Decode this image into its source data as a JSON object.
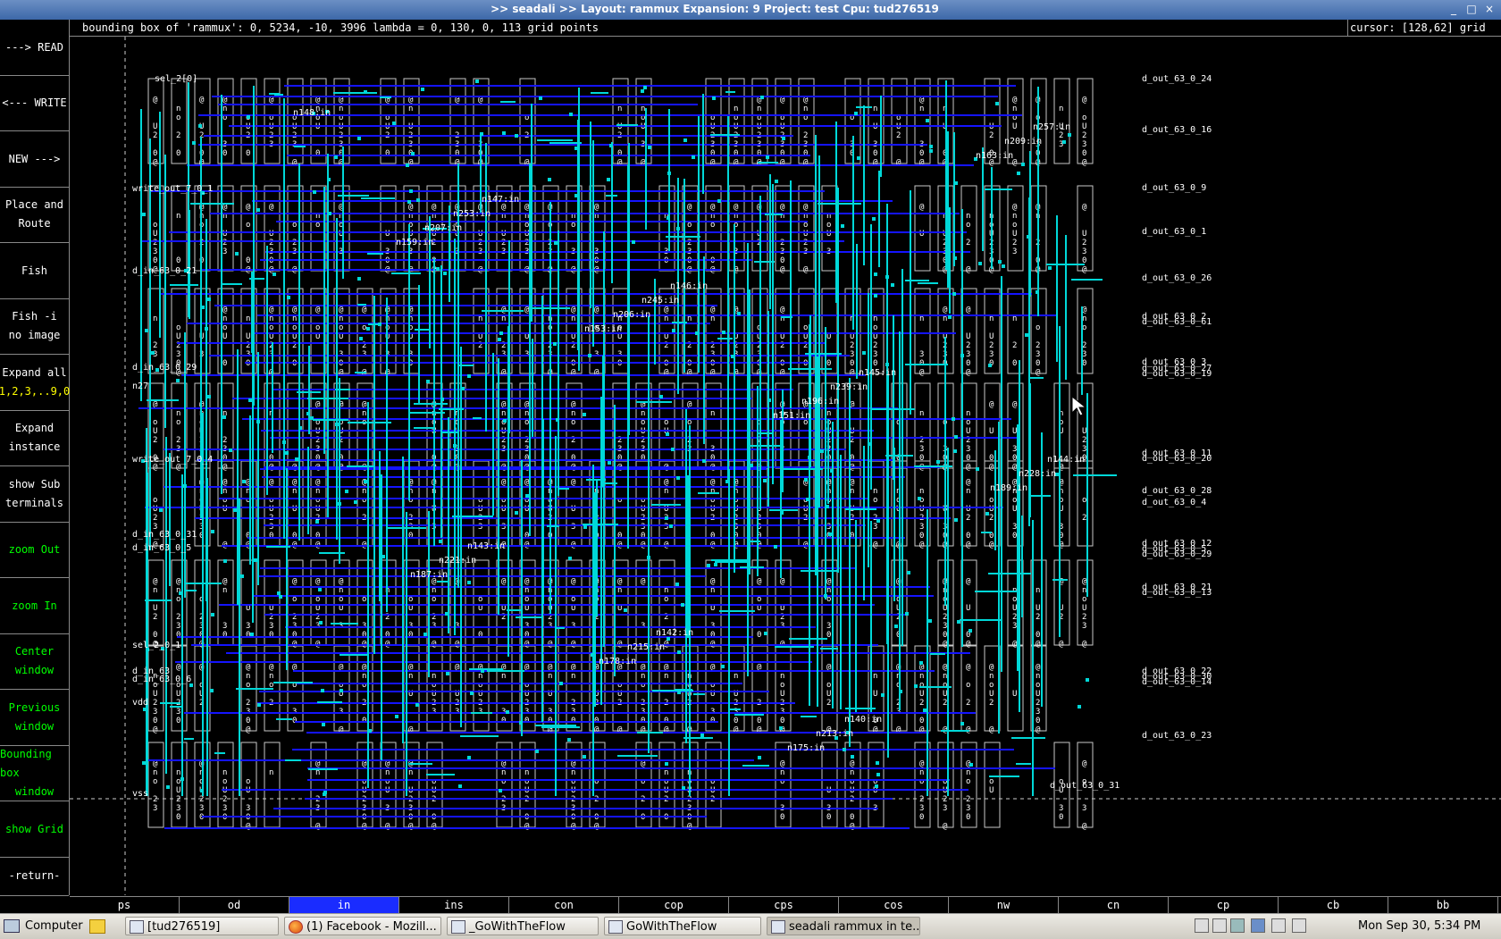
{
  "window": {
    "title": ">> seadali >>   Layout: rammux  Expansion: 9  Project: test  Cpu: tud276519",
    "buttons": [
      "_",
      "□",
      "×"
    ]
  },
  "info": {
    "bbox_text": "bounding box of 'rammux': 0, 5234, -10, 3996 lambda  =  0, 130, 0, 113  grid points",
    "cursor_text": "cursor: [128,62] grid"
  },
  "menu": [
    {
      "l1": "---> READ",
      "l2": "",
      "color": "white"
    },
    {
      "l1": "<--- WRITE",
      "l2": "",
      "color": "white"
    },
    {
      "l1": "NEW --->",
      "l2": "",
      "color": "white"
    },
    {
      "l1": "Place and",
      "l2": "Route",
      "color": "white"
    },
    {
      "l1": "Fish",
      "l2": "",
      "color": "white"
    },
    {
      "l1": "Fish -i",
      "l2": "no image",
      "color": "white"
    },
    {
      "l1": "Expand all",
      "l2": "1,2,3,..9,0",
      "color": "white"
    },
    {
      "l1": "Expand",
      "l2": "instance",
      "color": "white"
    },
    {
      "l1": "show Sub",
      "l2": "terminals",
      "color": "white"
    },
    {
      "l1": "zoom Out",
      "l2": "",
      "color": "green"
    },
    {
      "l1": "zoom In",
      "l2": "",
      "color": "green"
    },
    {
      "l1": "Center",
      "l2": "window",
      "color": "green"
    },
    {
      "l1": "Previous",
      "l2": "window",
      "color": "green"
    },
    {
      "l1": "Bounding box",
      "l2": "window",
      "color": "green"
    },
    {
      "l1": "show Grid",
      "l2": "",
      "color": "green"
    },
    {
      "l1": "-return-",
      "l2": "",
      "color": "white"
    }
  ],
  "layers": [
    "ps",
    "od",
    "in",
    "ins",
    "con",
    "cop",
    "cps",
    "cos",
    "nw",
    "cn",
    "cp",
    "cb",
    "bb"
  ],
  "active_layer": "in",
  "right_labels": [
    "d_out_63_0_24",
    "d_out_63_0_16",
    "d_out_63_0_9",
    "d_out_63_0_1",
    "d_out_63_0_26",
    "d_out_63_0_2",
    "d_out_63_0_61",
    "d_out_63_0_3",
    "d_out_63_0_27",
    "d_out_63_0_19",
    "d_out_63_0_11",
    "d_out_63_0_20",
    "d_out_63_0_28",
    "d_out_63_0_4",
    "d_out_63_0_12",
    "d_out_63_0_5",
    "d_out_63_0_29",
    "d_out_63_0_21",
    "d_out_63_0_13",
    "d_out_63_0_22",
    "d_out_63_0_30",
    "d_out_63_0_14",
    "d_out_63_0_23",
    "d_out_63_0_31"
  ],
  "left_labels": [
    "sel_2[0]",
    "write_out_7_0_1",
    "d_in_63_0_21",
    "d_in_63_0_29",
    "n27",
    "write_out_7_0_4",
    "d_in_63_0_31",
    "d_in_63_0_5",
    "sel_2_0_1",
    "d_in_63",
    "d_in_63_0_6",
    "vdd",
    "vss"
  ],
  "instance_labels": [
    "n148:in",
    "n147:in",
    "n146:in",
    "n145:in",
    "n144:in",
    "n143:in",
    "n142:in",
    "n140:in",
    "n257:in",
    "n253:in",
    "n245:in",
    "n239:in",
    "n228:in",
    "n221:in",
    "n215:in",
    "n213:in",
    "n209:in",
    "n207:in",
    "n206:in",
    "n196:in",
    "n189:in",
    "n187:in",
    "n178:in",
    "n175:in",
    "n163:in",
    "n159:in",
    "n153:in",
    "n151:in"
  ],
  "taskbar": {
    "start": "Computer",
    "tasks": [
      "[tud276519]",
      "(1) Facebook - Mozill...",
      "_GoWithTheFlow",
      "GoWithTheFlow",
      "seadali  rammux in te..."
    ],
    "active_task": 4,
    "clock": "Mon Sep 30,  5:34 PM"
  },
  "colors": {
    "metal_blue": "#1414ff",
    "cyan_wire": "#00d8d8",
    "cell_outline": "#c8c8c8",
    "active_layer_bg": "#1a2cff"
  }
}
